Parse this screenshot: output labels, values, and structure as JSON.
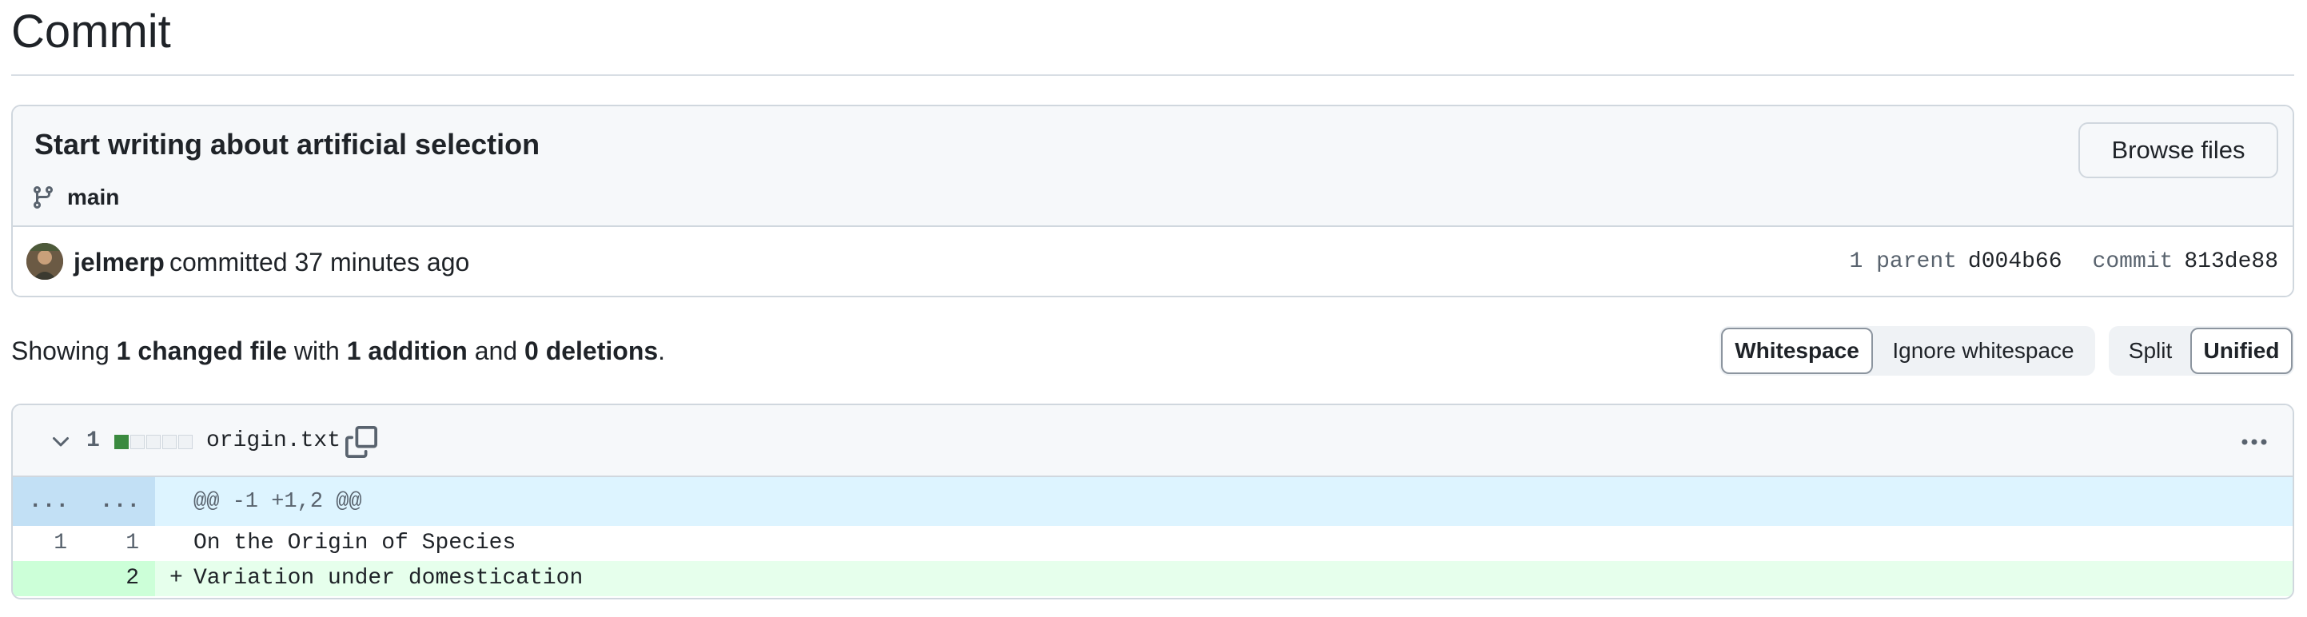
{
  "page": {
    "title": "Commit"
  },
  "commit": {
    "message": "Start writing about artificial selection",
    "branch": "main",
    "browse_label": "Browse files",
    "author": "jelmerp",
    "action_time": "committed 37 minutes ago",
    "parent_label": "1 parent",
    "parent_sha": "d004b66",
    "commit_label": "commit",
    "commit_sha": "813de88"
  },
  "summary": {
    "prefix": "Showing ",
    "changed": "1 changed file",
    "with": " with ",
    "additions": "1 addition",
    "and": " and ",
    "deletions": "0 deletions",
    "suffix": "."
  },
  "toggles": {
    "whitespace": "Whitespace",
    "ignore_whitespace": "Ignore whitespace",
    "split": "Split",
    "unified": "Unified"
  },
  "file": {
    "changes": "1",
    "name": "origin.txt",
    "diffstat": [
      "add",
      "neutral",
      "neutral",
      "neutral",
      "neutral"
    ],
    "hunk_left": "...",
    "hunk_right": "...",
    "hunk_header": "@@ -1 +1,2 @@",
    "lines": [
      {
        "type": "context",
        "old": "1",
        "new": "1",
        "marker": "",
        "text": "On the Origin of Species"
      },
      {
        "type": "addition",
        "old": "",
        "new": "2",
        "marker": "+",
        "text": "Variation under domestication"
      }
    ]
  },
  "colors": {
    "addition_bg": "#e6ffec",
    "addition_num_bg": "#ccffd8",
    "hunk_bg": "#ddf4ff",
    "hunk_num_bg": "#c2e0f5",
    "diffstat_add": "#3a8a3f"
  },
  "icons": {
    "branch": "git-branch-icon",
    "chevron": "chevron-down-icon",
    "copy": "copy-icon",
    "more": "kebab-horizontal-icon"
  }
}
